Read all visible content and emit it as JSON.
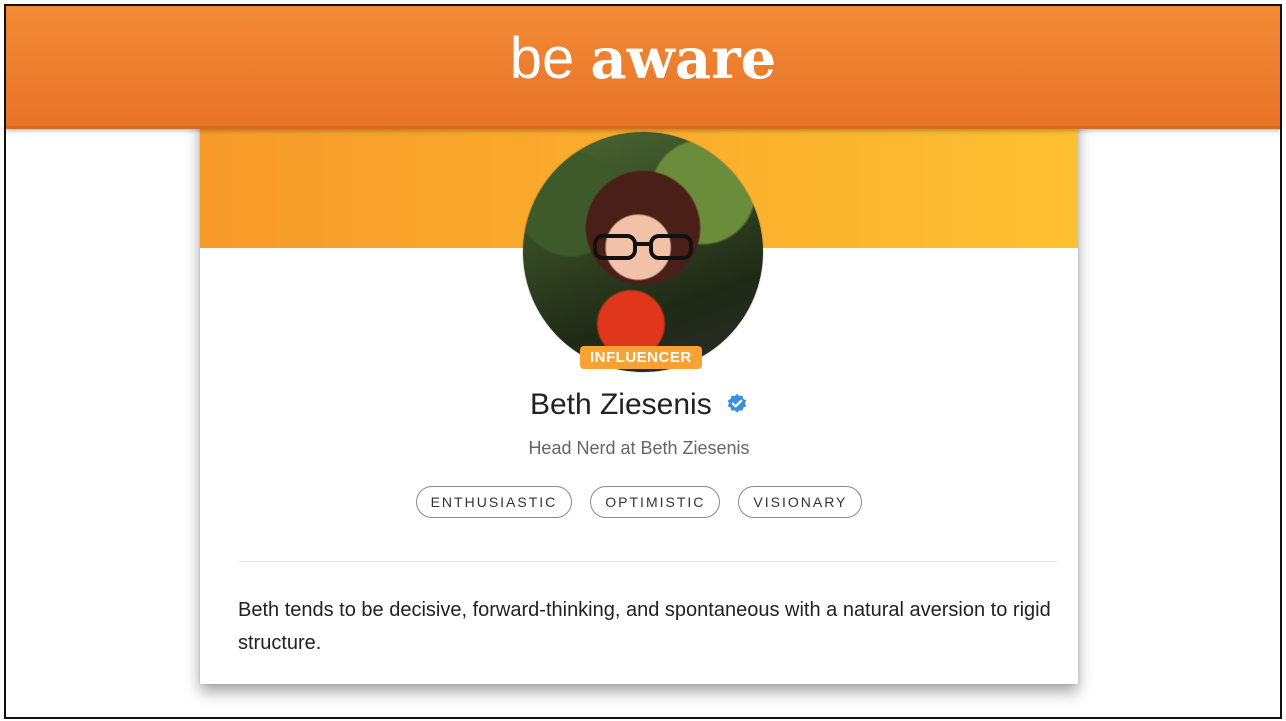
{
  "slide": {
    "title_light": "be",
    "title_bold": "aware"
  },
  "profile": {
    "badge": "INFLUENCER",
    "name": "Beth Ziesenis",
    "headline": "Head Nerd at Beth Ziesenis",
    "traits": [
      "ENTHUSIASTIC",
      "OPTIMISTIC",
      "VISIONARY"
    ],
    "bio": "Beth tends to be decisive, forward-thinking, and spontaneous with a natural aversion to rigid structure.",
    "verified_icon": "verified-check-icon",
    "colors": {
      "banner": "#ec7d2f",
      "header_gradient_start": "#f79a2a",
      "header_gradient_end": "#fdc031",
      "badge": "#f8a234",
      "verified": "#3b8fe0"
    }
  }
}
